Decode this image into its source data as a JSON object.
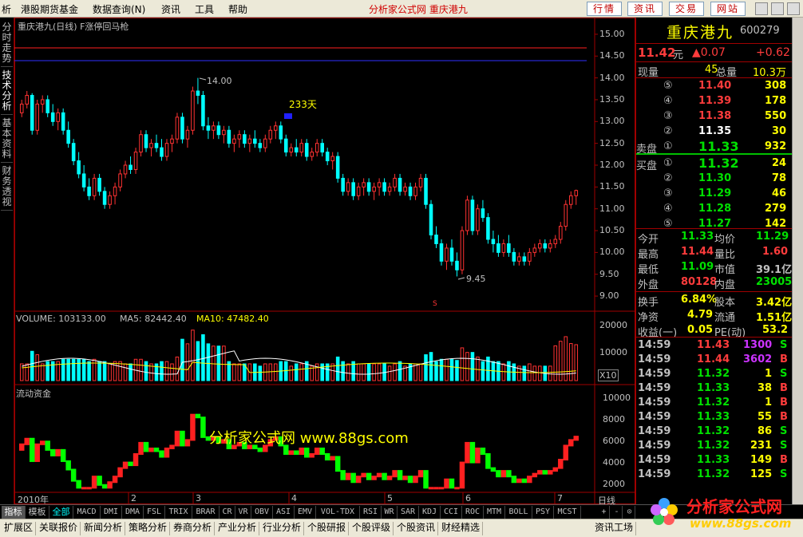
{
  "menu": {
    "items": [
      "析",
      "港股期货基金",
      "数据查询(N)",
      "资讯",
      "工具",
      "帮助"
    ],
    "brand": "分析家公式网  重庆港九",
    "buttons": [
      "行情",
      "资讯",
      "交易",
      "网站"
    ]
  },
  "left_tabs": [
    "分时走势",
    "技术分析",
    "基本资料",
    "财务透视"
  ],
  "chart": {
    "title": "重庆港九(日线) F涨停回马枪",
    "high_label": "14.00",
    "low_label": "9.45",
    "days_label": "233天",
    "marker_s": "S",
    "volume_header": {
      "volume": "VOLUME: 103133.00",
      "ma5": "MA5: 82442.40",
      "ma10": "MA10: 47482.40"
    },
    "flow_title": "流动资金",
    "watermark": "分析家公式网 www.88gs.com",
    "x_labels": [
      "2010年",
      "2",
      "3",
      "4",
      "5",
      "6",
      "7"
    ],
    "period": "日线",
    "x10": "X10",
    "price_ticks": [
      "15.00",
      "14.50",
      "14.00",
      "13.50",
      "13.00",
      "12.50",
      "12.00",
      "11.50",
      "11.00",
      "10.50",
      "10.00",
      "9.50",
      "9.00"
    ],
    "vol_ticks": [
      "20000",
      "10000"
    ],
    "flow_ticks": [
      "10000",
      "8000",
      "6000",
      "4000",
      "2000"
    ]
  },
  "chart_data": {
    "type": "candlestick",
    "price_range": [
      8.8,
      15.2
    ],
    "candles": [
      [
        13.2,
        13.5,
        13.1,
        13.4
      ],
      [
        13.4,
        13.7,
        13.3,
        13.6
      ],
      [
        13.6,
        13.65,
        12.7,
        12.8
      ],
      [
        12.8,
        13.5,
        12.7,
        13.4
      ],
      [
        13.4,
        13.6,
        13.2,
        13.5
      ],
      [
        13.5,
        13.6,
        13.1,
        13.2
      ],
      [
        13.2,
        13.4,
        12.9,
        13.0
      ],
      [
        13.0,
        13.3,
        12.8,
        13.2
      ],
      [
        13.2,
        13.3,
        12.7,
        12.8
      ],
      [
        12.8,
        13.0,
        12.4,
        12.5
      ],
      [
        12.5,
        12.6,
        12.0,
        12.1
      ],
      [
        12.1,
        12.3,
        11.7,
        11.8
      ],
      [
        11.8,
        12.0,
        11.4,
        11.5
      ],
      [
        11.5,
        11.7,
        11.2,
        11.3
      ],
      [
        11.3,
        11.8,
        11.2,
        11.7
      ],
      [
        11.7,
        11.8,
        11.3,
        11.4
      ],
      [
        11.4,
        11.5,
        11.0,
        11.1
      ],
      [
        11.1,
        11.4,
        11.0,
        11.3
      ],
      [
        11.3,
        11.6,
        11.1,
        11.5
      ],
      [
        11.5,
        11.9,
        11.4,
        11.8
      ],
      [
        11.8,
        12.1,
        11.7,
        12.0
      ],
      [
        12.0,
        12.2,
        11.8,
        11.9
      ],
      [
        11.9,
        12.4,
        11.8,
        12.3
      ],
      [
        12.3,
        12.8,
        12.2,
        12.7
      ],
      [
        12.7,
        12.8,
        12.3,
        12.4
      ],
      [
        12.4,
        12.6,
        12.2,
        12.5
      ],
      [
        12.5,
        12.7,
        12.3,
        12.4
      ],
      [
        12.4,
        12.6,
        12.1,
        12.2
      ],
      [
        12.2,
        12.6,
        12.1,
        12.5
      ],
      [
        12.5,
        12.7,
        12.3,
        12.6
      ],
      [
        12.6,
        13.2,
        12.5,
        13.1
      ],
      [
        13.1,
        13.2,
        12.5,
        12.6
      ],
      [
        12.6,
        12.9,
        12.4,
        12.8
      ],
      [
        12.8,
        13.8,
        12.7,
        13.7
      ],
      [
        13.7,
        14.0,
        13.4,
        13.6
      ],
      [
        13.6,
        13.7,
        12.8,
        12.9
      ],
      [
        12.9,
        13.1,
        12.6,
        12.8
      ],
      [
        12.8,
        13.0,
        12.6,
        12.9
      ],
      [
        12.9,
        13.0,
        12.6,
        12.7
      ],
      [
        12.7,
        12.9,
        12.5,
        12.8
      ],
      [
        12.8,
        12.9,
        12.4,
        12.5
      ],
      [
        12.5,
        12.7,
        12.3,
        12.6
      ],
      [
        12.6,
        12.8,
        12.4,
        12.7
      ],
      [
        12.7,
        12.8,
        12.4,
        12.5
      ],
      [
        12.5,
        12.7,
        12.3,
        12.6
      ],
      [
        12.6,
        12.8,
        12.4,
        12.5
      ],
      [
        12.5,
        12.6,
        12.3,
        12.4
      ],
      [
        12.4,
        12.7,
        12.3,
        12.6
      ],
      [
        12.6,
        12.9,
        12.5,
        12.8
      ],
      [
        12.8,
        13.0,
        12.6,
        12.9
      ],
      [
        12.9,
        13.0,
        12.5,
        12.6
      ],
      [
        12.6,
        12.7,
        12.2,
        12.3
      ],
      [
        12.3,
        12.5,
        12.2,
        12.4
      ],
      [
        12.4,
        12.6,
        12.2,
        12.3
      ],
      [
        12.3,
        12.6,
        12.2,
        12.5
      ],
      [
        12.5,
        12.6,
        12.1,
        12.2
      ],
      [
        12.2,
        12.4,
        12.1,
        12.3
      ],
      [
        12.3,
        12.6,
        12.2,
        12.5
      ],
      [
        12.5,
        12.6,
        12.2,
        12.3
      ],
      [
        12.3,
        12.4,
        12.0,
        12.1
      ],
      [
        12.1,
        12.3,
        11.9,
        12.2
      ],
      [
        12.2,
        12.3,
        11.6,
        11.7
      ],
      [
        11.7,
        11.8,
        11.3,
        11.4
      ],
      [
        11.4,
        11.7,
        11.3,
        11.6
      ],
      [
        11.6,
        11.7,
        11.2,
        11.3
      ],
      [
        11.3,
        11.6,
        11.2,
        11.5
      ],
      [
        11.5,
        11.7,
        11.3,
        11.6
      ],
      [
        11.6,
        11.7,
        11.3,
        11.4
      ],
      [
        11.4,
        11.6,
        11.2,
        11.5
      ],
      [
        11.5,
        11.7,
        11.3,
        11.6
      ],
      [
        11.6,
        11.7,
        11.3,
        11.4
      ],
      [
        11.4,
        11.6,
        11.3,
        11.5
      ],
      [
        11.5,
        11.8,
        11.4,
        11.7
      ],
      [
        11.7,
        11.8,
        11.3,
        11.4
      ],
      [
        11.4,
        11.6,
        11.3,
        11.5
      ],
      [
        11.5,
        11.6,
        11.2,
        11.3
      ],
      [
        11.3,
        11.6,
        11.2,
        11.5
      ],
      [
        11.5,
        11.8,
        11.4,
        11.7
      ],
      [
        11.7,
        11.8,
        11.0,
        11.1
      ],
      [
        11.1,
        11.2,
        10.3,
        10.4
      ],
      [
        10.4,
        10.6,
        10.1,
        10.2
      ],
      [
        10.2,
        10.3,
        9.7,
        9.8
      ],
      [
        9.8,
        10.2,
        9.6,
        10.1
      ],
      [
        10.1,
        10.3,
        9.7,
        9.8
      ],
      [
        9.8,
        10.0,
        9.45,
        9.6
      ],
      [
        9.6,
        10.6,
        9.5,
        10.5
      ],
      [
        10.5,
        11.3,
        10.4,
        11.2
      ],
      [
        11.2,
        11.3,
        10.4,
        10.5
      ],
      [
        10.5,
        11.1,
        10.4,
        11.0
      ],
      [
        11.0,
        11.2,
        10.7,
        10.8
      ],
      [
        10.8,
        10.9,
        10.2,
        10.3
      ],
      [
        10.3,
        10.5,
        10.0,
        10.2
      ],
      [
        10.2,
        10.4,
        9.9,
        10.0
      ],
      [
        10.0,
        10.3,
        9.9,
        10.2
      ],
      [
        10.2,
        10.4,
        9.9,
        10.0
      ],
      [
        10.0,
        10.1,
        9.7,
        9.8
      ],
      [
        9.8,
        10.0,
        9.7,
        9.9
      ],
      [
        9.9,
        10.0,
        9.7,
        9.8
      ],
      [
        9.8,
        10.1,
        9.7,
        10.0
      ],
      [
        10.0,
        10.2,
        9.9,
        10.1
      ],
      [
        10.1,
        10.3,
        10.0,
        10.2
      ],
      [
        10.2,
        10.3,
        10.0,
        10.1
      ],
      [
        10.1,
        10.3,
        10.0,
        10.2
      ],
      [
        10.2,
        10.4,
        10.1,
        10.3
      ],
      [
        10.3,
        10.7,
        10.2,
        10.6
      ],
      [
        10.6,
        11.2,
        10.5,
        11.1
      ],
      [
        11.1,
        11.4,
        11.0,
        11.3
      ],
      [
        11.3,
        11.44,
        11.09,
        11.42
      ]
    ],
    "volume_ticks": [
      20000,
      10000
    ],
    "flow_range": [
      1500,
      10500
    ]
  },
  "quote": {
    "name": "重庆港九",
    "code": "600279",
    "price": "11.42",
    "unit": "元",
    "change": "▲0.07",
    "pct": "+0.62",
    "xianliang_label": "现量",
    "xianliang": "45",
    "zongliang_label": "总量",
    "zongliang": "10.3万",
    "asks": [
      {
        "lv": "⑤",
        "p": "11.40",
        "v": "308"
      },
      {
        "lv": "④",
        "p": "11.39",
        "v": "178"
      },
      {
        "lv": "③",
        "p": "11.38",
        "v": "550"
      },
      {
        "lv": "②",
        "p": "11.35",
        "v": "30"
      },
      {
        "lv": "①",
        "p": "11.33",
        "v": "932",
        "label": "卖盘"
      }
    ],
    "bids": [
      {
        "lv": "①",
        "p": "11.32",
        "v": "24",
        "label": "买盘"
      },
      {
        "lv": "②",
        "p": "11.30",
        "v": "78"
      },
      {
        "lv": "③",
        "p": "11.29",
        "v": "46"
      },
      {
        "lv": "④",
        "p": "11.28",
        "v": "279"
      },
      {
        "lv": "⑤",
        "p": "11.27",
        "v": "142"
      }
    ],
    "stats": [
      [
        "今开",
        "11.33",
        "均价",
        "11.29"
      ],
      [
        "最高",
        "11.44",
        "量比",
        "1.60"
      ],
      [
        "最低",
        "11.09",
        "市值",
        "39.1亿"
      ],
      [
        "外盘",
        "80128",
        "内盘",
        "23005"
      ]
    ],
    "stats2": [
      [
        "换手",
        "6.84%",
        "股本",
        "3.42亿"
      ],
      [
        "净资",
        "4.79",
        "流通",
        "1.51亿"
      ],
      [
        "收益(一)",
        "0.05",
        "PE(动)",
        "53.2"
      ]
    ],
    "ticks": [
      [
        "14:59",
        "11.43",
        "1300",
        "S"
      ],
      [
        "14:59",
        "11.44",
        "3602",
        "B"
      ],
      [
        "14:59",
        "11.32",
        "1",
        "S"
      ],
      [
        "14:59",
        "11.33",
        "38",
        "B"
      ],
      [
        "14:59",
        "11.32",
        "1",
        "B"
      ],
      [
        "14:59",
        "11.33",
        "55",
        "B"
      ],
      [
        "14:59",
        "11.32",
        "86",
        "S"
      ],
      [
        "14:59",
        "11.32",
        "231",
        "S"
      ],
      [
        "14:59",
        "11.33",
        "149",
        "B"
      ],
      [
        "14:59",
        "11.32",
        "125",
        "S"
      ]
    ]
  },
  "ind_tabs": [
    "指标",
    "模板",
    "全部",
    "MACD",
    "DMI",
    "DMA",
    "FSL",
    "TRIX",
    "BRAR",
    "CR",
    "VR",
    "OBV",
    "ASI",
    "EMV",
    "VOL-TDX",
    "RSI",
    "WR",
    "SAR",
    "KDJ",
    "CCI",
    "ROC",
    "MTM",
    "BOLL",
    "PSY",
    "MCST"
  ],
  "ind_right": [
    "+",
    "-",
    "⊙"
  ],
  "nav_tabs": [
    "扩展区",
    "关联报价",
    "新闻分析",
    "策略分析",
    "券商分析",
    "产业分析",
    "行业分析",
    "个股研报",
    "个股评级",
    "个股资讯",
    "财经精选"
  ],
  "nav_right": "资讯工场",
  "logo": {
    "text": "分析家公式网",
    "url": "www.88gs.com"
  },
  "colors": {
    "up": "#ff3232",
    "down": "#00ffff",
    "price_up": "#ff3c3c",
    "price_down": "#00e000",
    "yellow": "#ffff00"
  }
}
